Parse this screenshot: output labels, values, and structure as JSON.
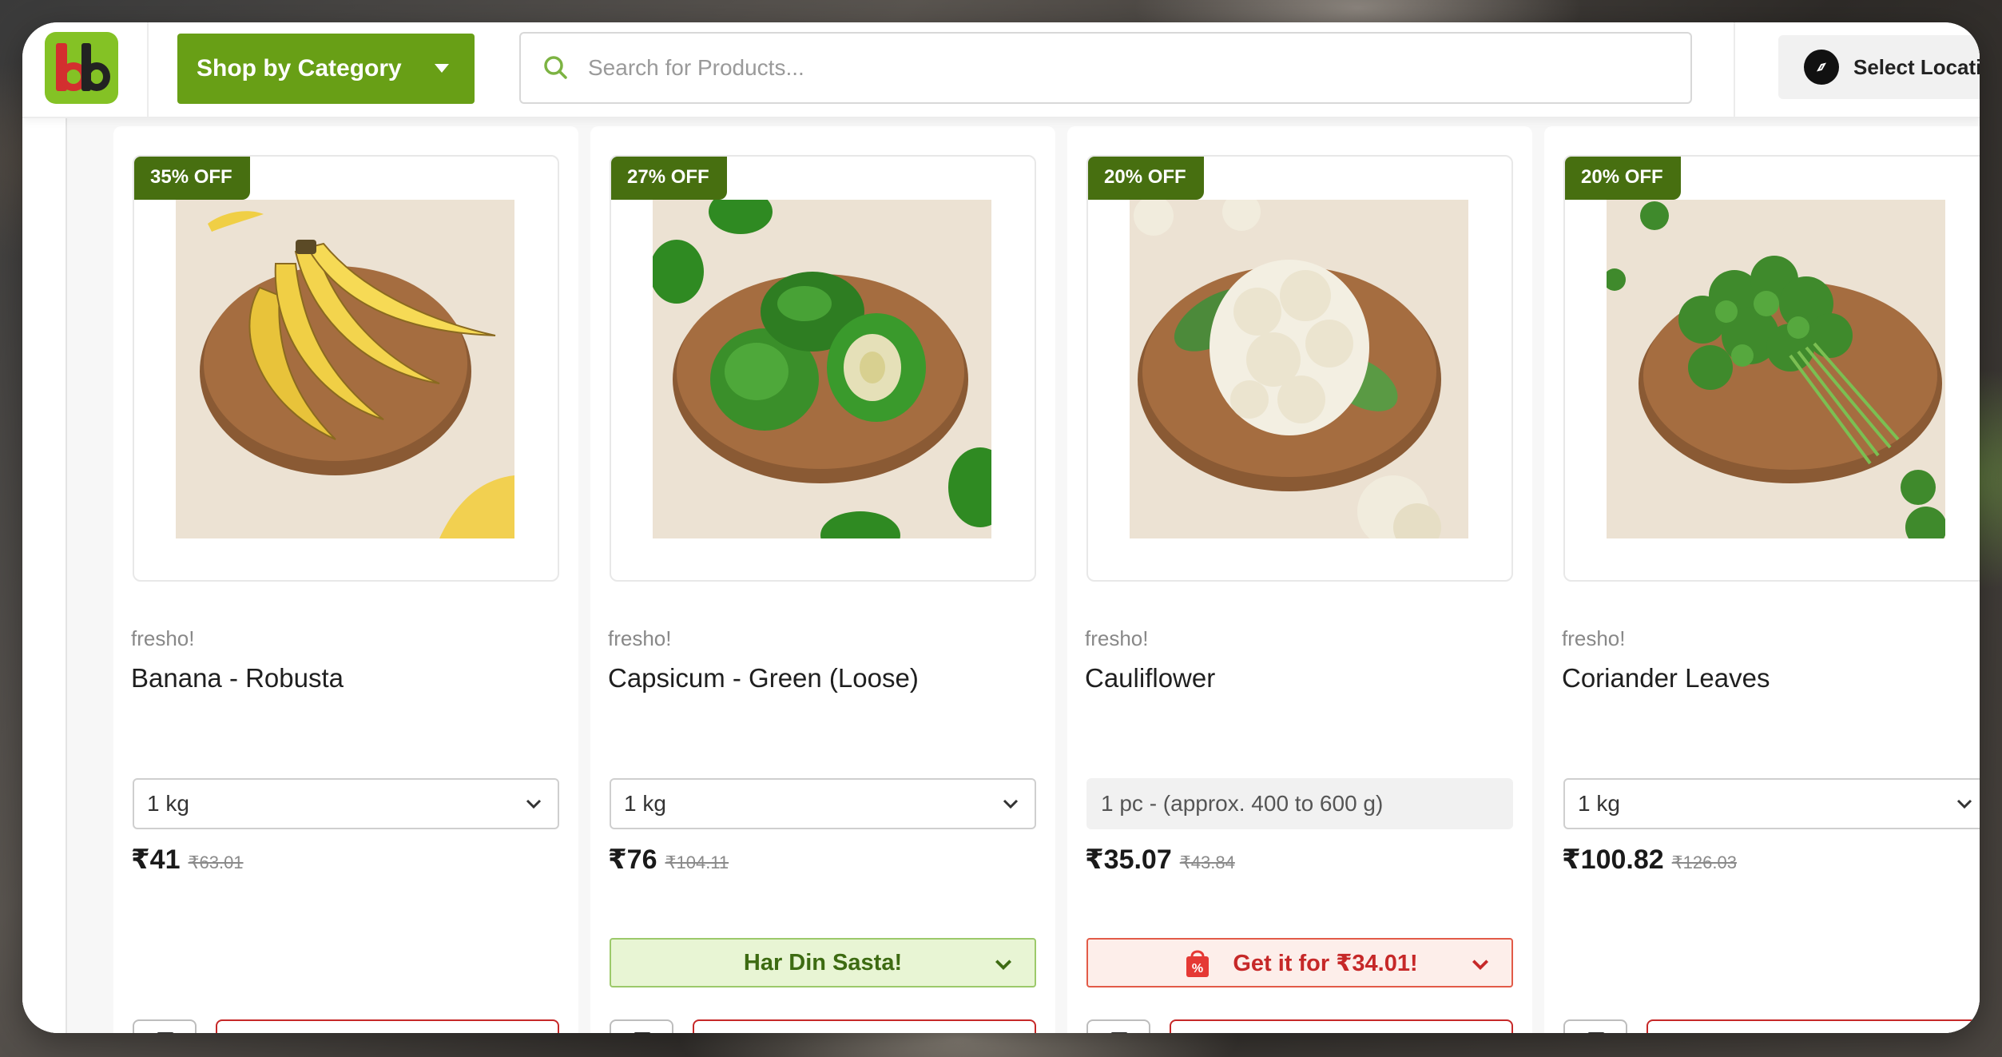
{
  "header": {
    "logo_alt": "bb",
    "category_button": "Shop by Category",
    "search_placeholder": "Search for Products...",
    "location_button": "Select Location"
  },
  "products": [
    {
      "discount": "35% OFF",
      "brand": "fresho!",
      "name": "Banana - Robusta",
      "variant": "1 kg",
      "variant_selectable": true,
      "price": "₹41",
      "mrp": "₹63.01",
      "offer": null
    },
    {
      "discount": "27% OFF",
      "brand": "fresho!",
      "name": "Capsicum - Green (Loose)",
      "variant": "1 kg",
      "variant_selectable": true,
      "price": "₹76",
      "mrp": "₹104.11",
      "offer": {
        "text": "Har Din Sasta!",
        "style": "green"
      }
    },
    {
      "discount": "20% OFF",
      "brand": "fresho!",
      "name": "Cauliflower",
      "variant": "1 pc - (approx. 400 to 600 g)",
      "variant_selectable": false,
      "price": "₹35.07",
      "mrp": "₹43.84",
      "offer": {
        "text": "Get it for ₹34.01!",
        "style": "red"
      }
    },
    {
      "discount": "20% OFF",
      "brand": "fresho!",
      "name": "Coriander Leaves",
      "variant": "1 kg",
      "variant_selectable": true,
      "price": "₹100.82",
      "mrp": "₹126.03",
      "offer": null
    }
  ],
  "colors": {
    "brand_green": "#689f16",
    "badge_green": "#476f10",
    "logo_green": "#84c225",
    "offer_red": "#c62828"
  }
}
